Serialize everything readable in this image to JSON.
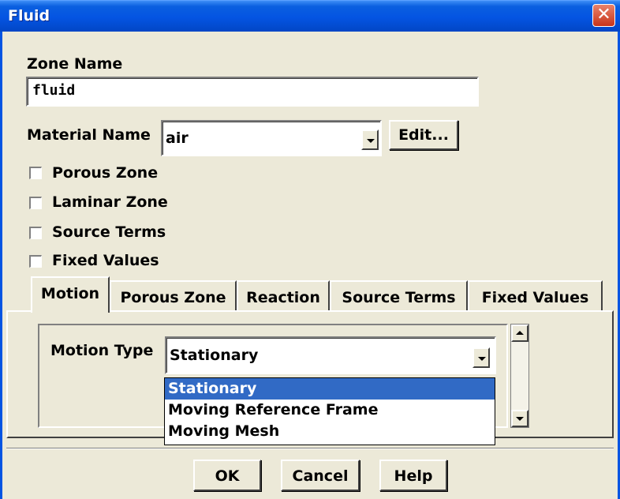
{
  "window": {
    "title": "Fluid",
    "close_glyph": "✕"
  },
  "zone_name": {
    "label": "Zone Name",
    "value": "fluid"
  },
  "material": {
    "label": "Material Name",
    "value": "air",
    "edit_button": "Edit..."
  },
  "checkboxes": [
    {
      "label": "Porous Zone",
      "checked": false
    },
    {
      "label": "Laminar Zone",
      "checked": false
    },
    {
      "label": "Source Terms",
      "checked": false
    },
    {
      "label": "Fixed Values",
      "checked": false
    }
  ],
  "tabs": [
    {
      "label": "Motion",
      "active": true
    },
    {
      "label": "Porous Zone",
      "active": false
    },
    {
      "label": "Reaction",
      "active": false
    },
    {
      "label": "Source Terms",
      "active": false
    },
    {
      "label": "Fixed Values",
      "active": false
    }
  ],
  "motion": {
    "type_label": "Motion Type",
    "selected": "Stationary",
    "options": [
      {
        "label": "Stationary",
        "highlighted": true
      },
      {
        "label": "Moving Reference Frame",
        "highlighted": false
      },
      {
        "label": "Moving Mesh",
        "highlighted": false
      }
    ]
  },
  "buttons": {
    "ok": "OK",
    "cancel": "Cancel",
    "help": "Help"
  },
  "colors": {
    "titlebar": "#0454e2",
    "face": "#ece9d8",
    "highlight": "#316ac5",
    "close": "#d9523a"
  }
}
